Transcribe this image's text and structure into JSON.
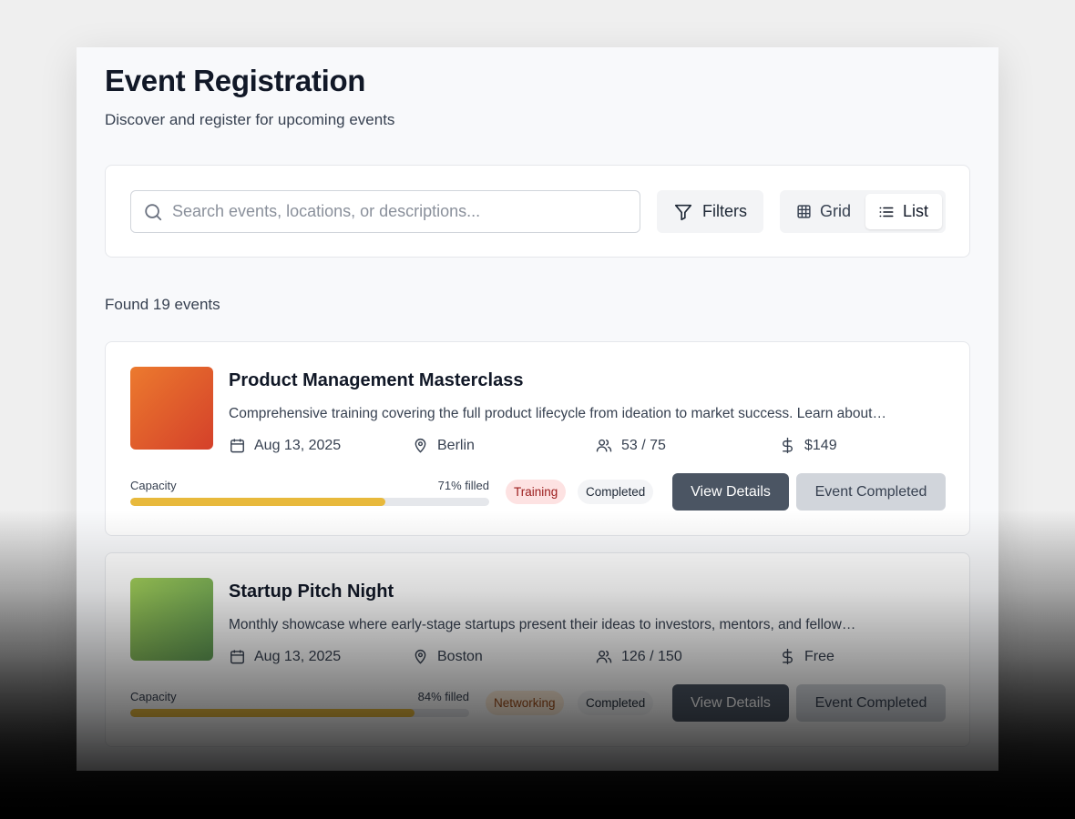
{
  "header": {
    "title": "Event Registration",
    "subtitle": "Discover and register for upcoming events"
  },
  "search": {
    "value": "",
    "placeholder": "Search events, locations, or descriptions...",
    "icon": "search-icon"
  },
  "toolbar": {
    "filters_label": "Filters",
    "view_grid_label": "Grid",
    "view_list_label": "List",
    "active_view": "List"
  },
  "results": {
    "count_text": "Found 19 events"
  },
  "events": [
    {
      "title": "Product Management Masterclass",
      "description": "Comprehensive training covering the full product lifecycle from ideation to market success. Learn about…",
      "date": "Aug 13, 2025",
      "location": "Berlin",
      "attendance": "53 / 75",
      "price": "$149",
      "capacity_label": "Capacity",
      "capacity_text": "71% filled",
      "capacity_fraction": 0.71,
      "category": "Training",
      "status": "Completed",
      "view_label": "View Details",
      "action_label": "Event Completed",
      "thumb_colors": [
        "#ec7a2e",
        "#d4402a"
      ],
      "category_colors": {
        "bg": "#fde2e2",
        "fg": "#9b1c1c"
      }
    },
    {
      "title": "Startup Pitch Night",
      "description": "Monthly showcase where early-stage startups present their ideas to investors, mentors, and fellow…",
      "date": "Aug 13, 2025",
      "location": "Boston",
      "attendance": "126 / 150",
      "price": "Free",
      "capacity_label": "Capacity",
      "capacity_text": "84% filled",
      "capacity_fraction": 0.84,
      "category": "Networking",
      "status": "Completed",
      "view_label": "View Details",
      "action_label": "Event Completed",
      "thumb_colors": [
        "#a3d05a",
        "#5f9a55"
      ],
      "category_colors": {
        "bg": "#fdecd8",
        "fg": "#9a4a16"
      }
    }
  ]
}
